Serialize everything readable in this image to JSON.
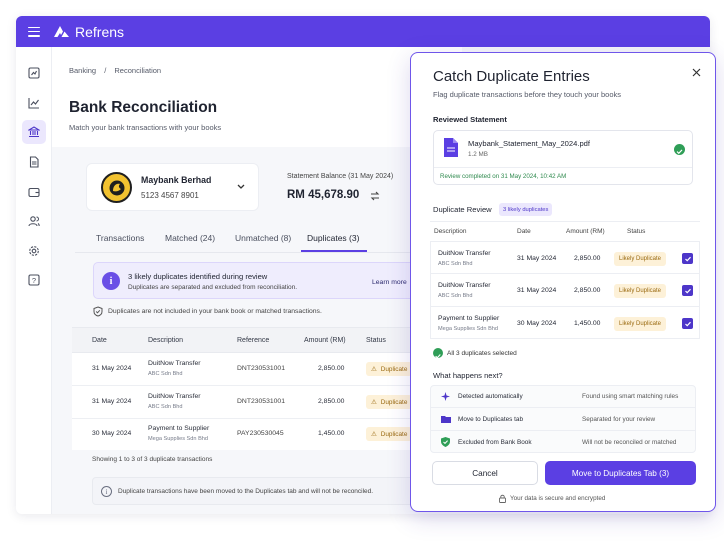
{
  "app": {
    "name": "Refrens",
    "brand_color": "#5b3fe3"
  },
  "sidebar": {
    "icons": [
      "reports-icon",
      "chart-icon",
      "bank-icon",
      "document-icon",
      "wallet-icon",
      "users-icon",
      "gear-icon",
      "help-icon"
    ]
  },
  "breadcrumb": {
    "root": "Banking",
    "sep": "/",
    "current": "Reconciliation"
  },
  "page": {
    "title": "Bank Reconciliation",
    "subtitle": "Match your bank transactions with your books"
  },
  "bank": {
    "name": "Maybank Berhad",
    "account": "5123 4567 8901"
  },
  "balance": {
    "label": "Statement Balance (31 May 2024)",
    "value": "RM 45,678.90"
  },
  "tabs": [
    {
      "label": "Transactions"
    },
    {
      "label": "Matched (24)"
    },
    {
      "label": "Unmatched (8)"
    },
    {
      "label": "Duplicates (3)"
    }
  ],
  "alert": {
    "title": "3 likely duplicates identified during review",
    "body": "Duplicates are separated and excluded from reconciliation.",
    "link": "Learn more"
  },
  "note": "Duplicates are not included in your bank book or matched transactions.",
  "table": {
    "headers": [
      "Date",
      "Description",
      "Reference",
      "Amount (RM)",
      "Status"
    ],
    "rows": [
      {
        "date": "31 May 2024",
        "desc": "DuitNow Transfer",
        "sub": "ABC Sdn Bhd",
        "ref": "DNT230531001",
        "amount": "2,850.00",
        "status": "Duplicate"
      },
      {
        "date": "31 May 2024",
        "desc": "DuitNow Transfer",
        "sub": "ABC Sdn Bhd",
        "ref": "DNT230531001",
        "amount": "2,850.00",
        "status": "Duplicate"
      },
      {
        "date": "30 May 2024",
        "desc": "Payment to Supplier",
        "sub": "Mega Supplies Sdn Bhd",
        "ref": "PAY230530045",
        "amount": "1,450.00",
        "status": "Duplicate"
      }
    ],
    "footer": "Showing 1 to 3 of 3 duplicate transactions"
  },
  "info": "Duplicate transactions have been moved to the Duplicates tab and will not be reconciled.",
  "modal": {
    "title": "Catch Duplicate Entries",
    "subtitle": "Flag duplicate transactions before they touch your books",
    "reviewed_label": "Reviewed Statement",
    "file": {
      "name": "Maybank_Statement_May_2024.pdf",
      "size": "1.2 MB"
    },
    "review_done": "Review completed on 31 May 2024, 10:42 AM",
    "dup_review": "Duplicate Review",
    "dup_badge": "3 likely duplicates",
    "headers": [
      "Description",
      "Date",
      "Amount (RM)",
      "Status"
    ],
    "rows": [
      {
        "desc": "DuitNow Transfer",
        "sub": "ABC Sdn Bhd",
        "date": "31 May 2024",
        "amount": "2,850.00",
        "status": "Likely Duplicate"
      },
      {
        "desc": "DuitNow Transfer",
        "sub": "ABC Sdn Bhd",
        "date": "31 May 2024",
        "amount": "2,850.00",
        "status": "Likely Duplicate"
      },
      {
        "desc": "Payment to Supplier",
        "sub": "Mega Supplies Sdn Bhd",
        "date": "30 May 2024",
        "amount": "1,450.00",
        "status": "Likely Duplicate"
      }
    ],
    "all_selected": "All 3 duplicates selected",
    "next_title": "What happens next?",
    "steps": [
      {
        "label": "Detected automatically",
        "desc": "Found using smart matching rules"
      },
      {
        "label": "Move to Duplicates tab",
        "desc": "Separated for your review"
      },
      {
        "label": "Excluded from Bank Book",
        "desc": "Will not be reconciled or matched"
      }
    ],
    "cancel": "Cancel",
    "confirm": "Move to Duplicates Tab (3)",
    "secure": "Your data is secure and encrypted"
  }
}
